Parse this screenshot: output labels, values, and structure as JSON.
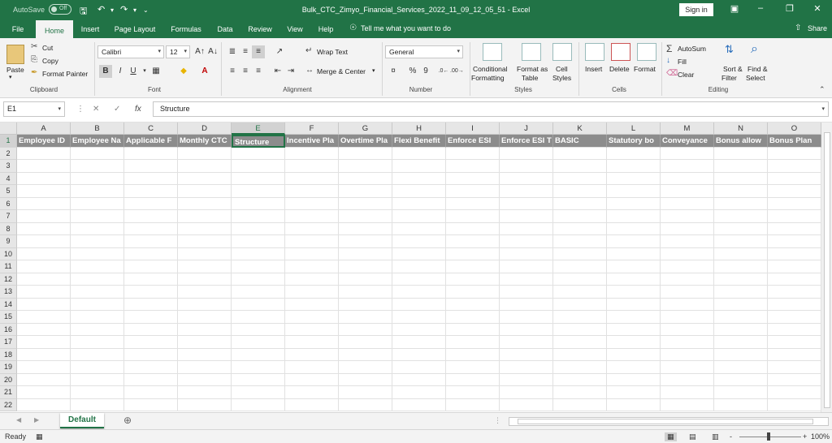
{
  "titlebar": {
    "autosave_label": "AutoSave",
    "autosave_state": "Off",
    "title": "Bulk_CTC_Zimyo_Financial_Services_2022_11_09_12_05_51  -  Excel",
    "signin_label": "Sign in",
    "save_icon": "save-icon",
    "undo_icon": "undo-icon",
    "redo_icon": "redo-icon"
  },
  "menu": {
    "tabs": [
      "File",
      "Home",
      "Insert",
      "Page Layout",
      "Formulas",
      "Data",
      "Review",
      "View",
      "Help"
    ],
    "active_tab": "Home",
    "tell_me": "Tell me what you want to do",
    "share_label": "Share"
  },
  "ribbon": {
    "clipboard": {
      "paste": "Paste",
      "cut": "Cut",
      "copy": "Copy",
      "format_painter": "Format Painter",
      "label": "Clipboard"
    },
    "font": {
      "name": "Calibri",
      "size": "12",
      "bold": "B",
      "italic": "I",
      "underline": "U",
      "label": "Font"
    },
    "alignment": {
      "wrap_text": "Wrap Text",
      "merge_center": "Merge & Center",
      "label": "Alignment"
    },
    "number": {
      "format": "General",
      "percent": "%",
      "comma": "9",
      "label": "Number"
    },
    "styles": {
      "conditional_formatting_1": "Conditional",
      "conditional_formatting_2": "Formatting",
      "format_as_table_1": "Format as",
      "format_as_table_2": "Table",
      "cell_styles_1": "Cell",
      "cell_styles_2": "Styles",
      "label": "Styles"
    },
    "cells": {
      "insert": "Insert",
      "delete": "Delete",
      "format": "Format",
      "label": "Cells"
    },
    "editing": {
      "autosum": "AutoSum",
      "fill": "Fill",
      "clear": "Clear",
      "sort_filter_1": "Sort &",
      "sort_filter_2": "Filter",
      "find_select_1": "Find &",
      "find_select_2": "Select",
      "label": "Editing"
    }
  },
  "formula_bar": {
    "name_box": "E1",
    "cancel_icon": "cancel-icon",
    "enter_icon": "enter-icon",
    "fx_label": "fx",
    "content": "Structure"
  },
  "sheet": {
    "columns": [
      "A",
      "B",
      "C",
      "D",
      "E",
      "F",
      "G",
      "H",
      "I",
      "J",
      "K",
      "L",
      "M",
      "N",
      "O"
    ],
    "selected_column": "E",
    "rows": [
      "1",
      "2",
      "3",
      "4",
      "5",
      "6",
      "7",
      "8",
      "9",
      "10",
      "11",
      "12",
      "13",
      "14",
      "15",
      "16",
      "17",
      "18",
      "19",
      "20",
      "21",
      "22"
    ],
    "selected_row": "1",
    "row1_values": [
      "Employee ID",
      "Employee Name",
      "Applicable From",
      "Monthly CTC",
      "Structure",
      "Incentive Plan",
      "Overtime Plan",
      "Flexi Benefits",
      "Enforce ESI",
      "Enforce ESI",
      "BASIC",
      "Statutory bonus",
      "Conveyance",
      "Bonus allowance",
      "Bonus Plan"
    ],
    "row1_display": [
      "Employee ID",
      "Employee Na",
      "Applicable F",
      "Monthly CTC",
      "Structure",
      "Incentive Pla",
      "Overtime Pla",
      "Flexi Benefit",
      "Enforce ESI",
      "Enforce ESI T",
      "BASIC",
      "Statutory bo",
      "Conveyance",
      "Bonus allow",
      "Bonus Plan"
    ],
    "header_fill": "#8c8c8c",
    "accent": "#217346"
  },
  "sheet_tabs": {
    "active": "Default",
    "add_icon": "add-sheet-icon"
  },
  "statusbar": {
    "ready": "Ready",
    "zoom": "100%",
    "minus": "-",
    "plus": "+"
  }
}
